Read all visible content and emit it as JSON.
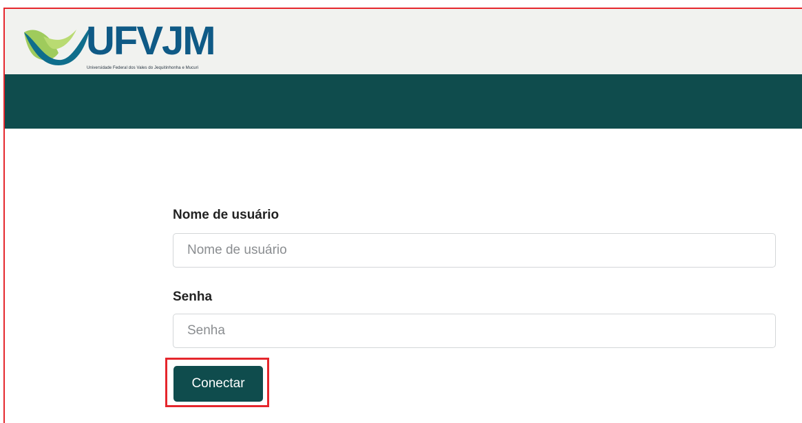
{
  "brand": {
    "name": "UFVJM",
    "tagline": "Universidade Federal dos Vales do Jequitinhonha e Mucuri",
    "primary_color": "#0f4c4d",
    "logo_text_color": "#0f5a86",
    "icon": "ufvjm-logo-mark"
  },
  "login": {
    "username_label": "Nome de usuário",
    "username_placeholder": "Nome de usuário",
    "password_label": "Senha",
    "password_placeholder": "Senha",
    "submit_label": "Conectar"
  },
  "annotations": {
    "highlight_color": "#e5262c"
  }
}
